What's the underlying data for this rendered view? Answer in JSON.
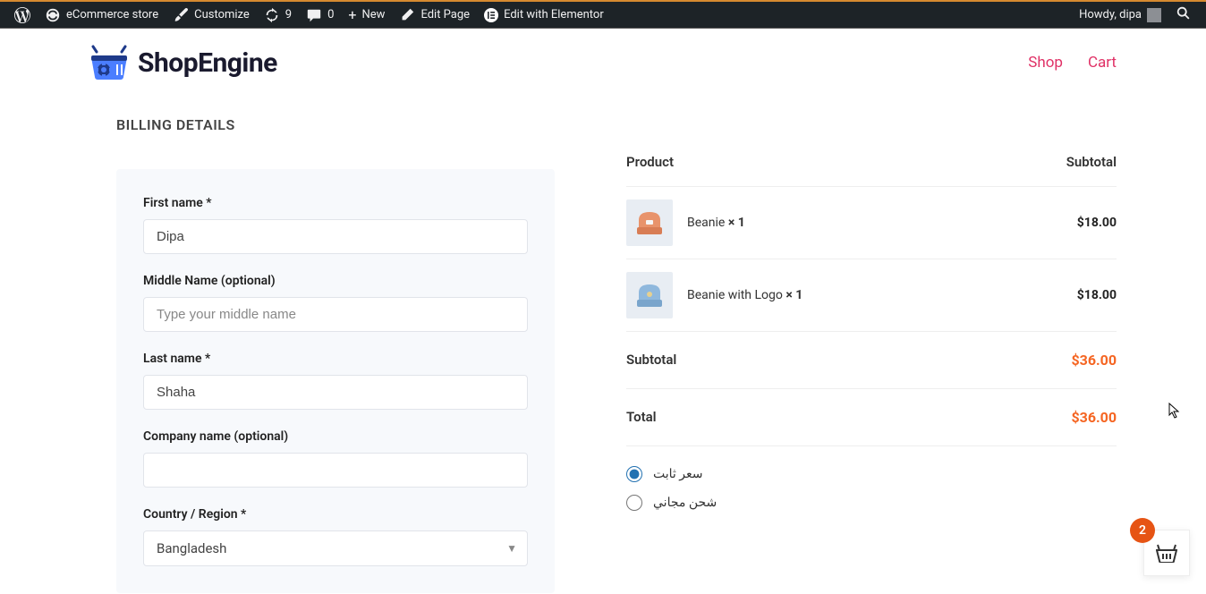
{
  "adminbar": {
    "site_name": "eCommerce store",
    "customize": "Customize",
    "updates_count": "9",
    "comments_count": "0",
    "new": "New",
    "edit_page": "Edit Page",
    "edit_elementor": "Edit with Elementor",
    "howdy": "Howdy, dipa"
  },
  "header": {
    "brand": "ShopEngine",
    "nav": {
      "shop": "Shop",
      "cart": "Cart"
    }
  },
  "billing": {
    "title": "BILLING DETAILS",
    "first_name_label": "First name *",
    "first_name_value": "Dipa",
    "middle_name_label": "Middle Name (optional)",
    "middle_name_placeholder": "Type your middle name",
    "last_name_label": "Last name *",
    "last_name_value": "Shaha",
    "company_label": "Company name (optional)",
    "company_value": "",
    "country_label": "Country / Region *",
    "country_value": "Bangladesh"
  },
  "order": {
    "product_header": "Product",
    "subtotal_header": "Subtotal",
    "items": [
      {
        "name": "Beanie",
        "qty": "× 1",
        "price": "$18.00"
      },
      {
        "name": "Beanie with Logo",
        "qty": "× 1",
        "price": "$18.00"
      }
    ],
    "subtotal_label": "Subtotal",
    "subtotal_value": "$36.00",
    "total_label": "Total",
    "total_value": "$36.00",
    "shipping": [
      {
        "label": "سعر ثابت",
        "checked": true
      },
      {
        "label": "شحن مجاني",
        "checked": false
      }
    ]
  },
  "float_cart": {
    "count": "2"
  }
}
